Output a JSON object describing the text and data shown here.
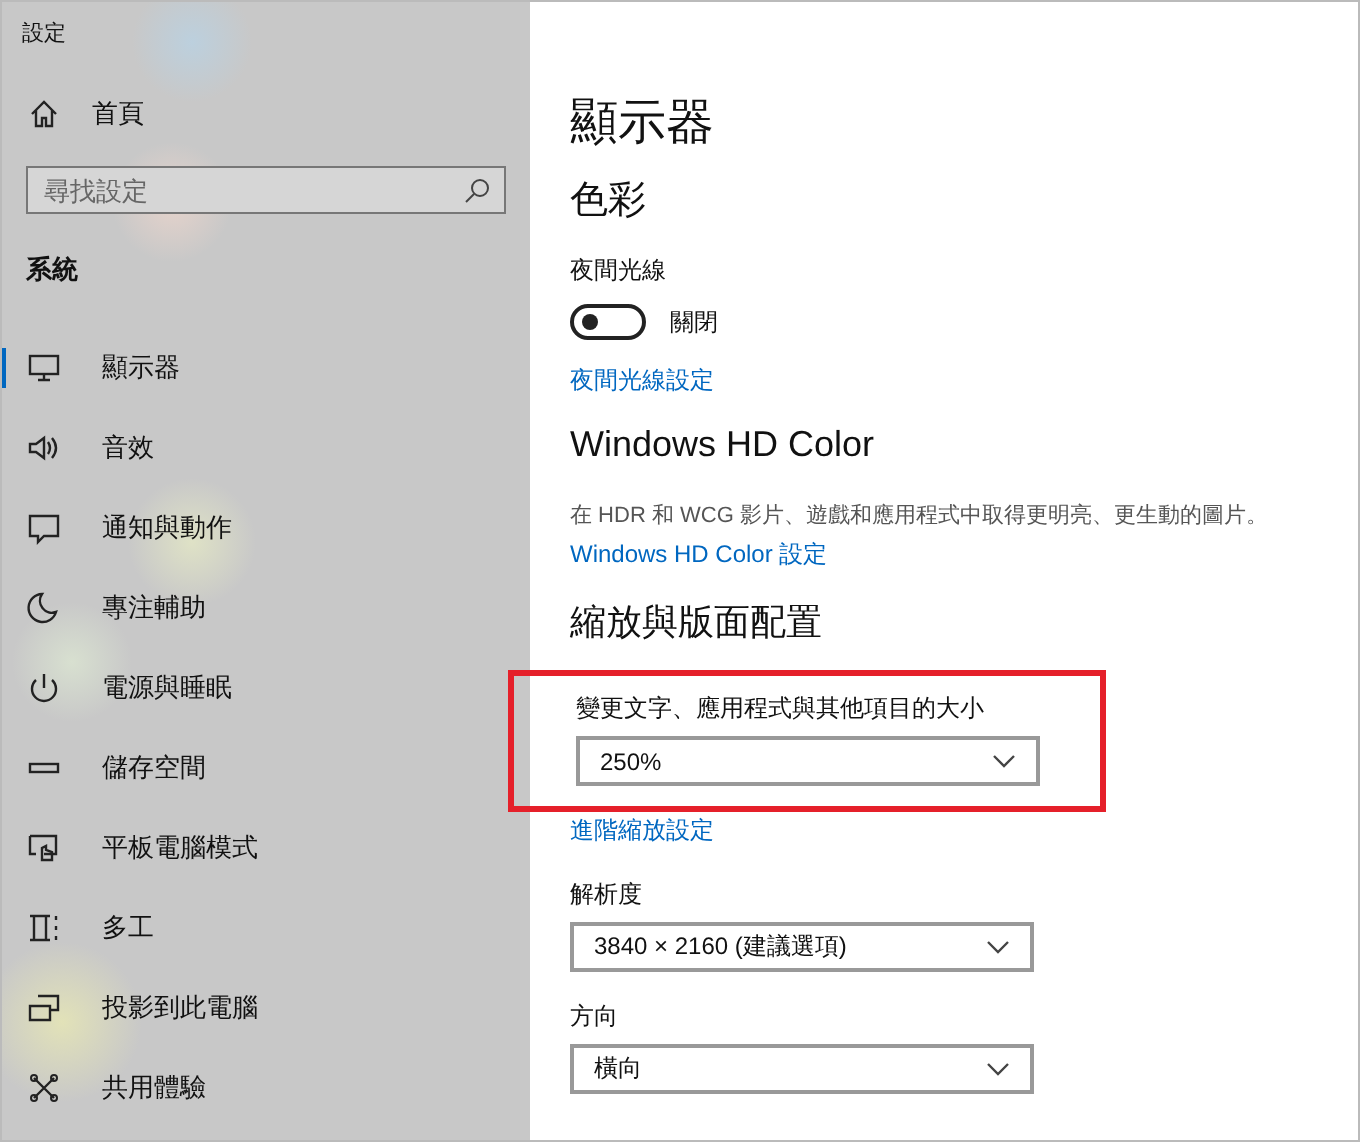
{
  "window": {
    "title": "設定"
  },
  "sidebar": {
    "home": "首頁",
    "search": {
      "placeholder": "尋找設定"
    },
    "section": "系統",
    "items": [
      {
        "label": "顯示器",
        "selected": true
      },
      {
        "label": "音效",
        "selected": false
      },
      {
        "label": "通知與動作",
        "selected": false
      },
      {
        "label": "專注輔助",
        "selected": false
      },
      {
        "label": "電源與睡眠",
        "selected": false
      },
      {
        "label": "儲存空間",
        "selected": false
      },
      {
        "label": "平板電腦模式",
        "selected": false
      },
      {
        "label": "多工",
        "selected": false
      },
      {
        "label": "投影到此電腦",
        "selected": false
      },
      {
        "label": "共用體驗",
        "selected": false
      }
    ]
  },
  "page": {
    "title": "顯示器",
    "color": {
      "heading": "色彩",
      "night_light": {
        "label": "夜間光線",
        "on": false,
        "state": "關閉"
      },
      "link": "夜間光線設定"
    },
    "hd_color": {
      "heading": "Windows HD Color",
      "description": "在 HDR 和 WCG 影片、遊戲和應用程式中取得更明亮、更生動的圖片。",
      "link": "Windows HD Color 設定"
    },
    "scale_layout": {
      "heading": "縮放與版面配置",
      "scale": {
        "label": "變更文字、應用程式與其他項目的大小",
        "value": "250%",
        "highlighted": true
      },
      "link": "進階縮放設定",
      "resolution": {
        "label": "解析度",
        "value": "3840 × 2160 (建議選項)"
      },
      "orientation": {
        "label": "方向",
        "value": "橫向"
      }
    }
  }
}
